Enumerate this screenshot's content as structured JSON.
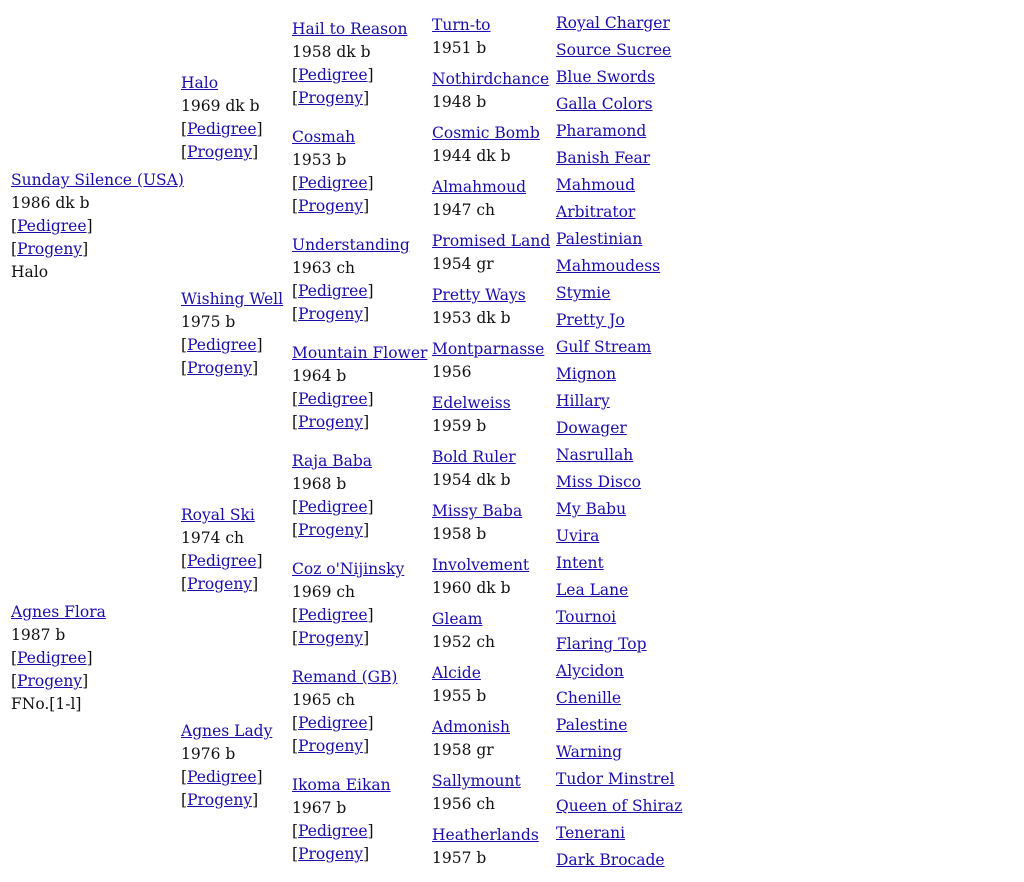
{
  "link_open": "[",
  "link_close": "]",
  "pedigree_label": "Pedigree",
  "progeny_label": "Progeny",
  "sire": {
    "name": "Sunday Silence (USA) ",
    "info": "1986 dk b",
    "note": "Halo"
  },
  "dam": {
    "name": "Agnes Flora ",
    "info": "1987 b",
    "note": "FNo.[1-l]"
  },
  "gen2": [
    {
      "name": "Halo ",
      "info": "1969 dk b"
    },
    {
      "name": "Wishing Well ",
      "info": "1975 b"
    },
    {
      "name": "Royal Ski ",
      "info": "1974 ch"
    },
    {
      "name": "Agnes Lady ",
      "info": "1976 b"
    }
  ],
  "gen3": [
    {
      "name": "Hail to Reason ",
      "info": "1958 dk b"
    },
    {
      "name": "Cosmah",
      "info": "1953 b"
    },
    {
      "name": "Understanding ",
      "info": "1963 ch"
    },
    {
      "name": "Mountain Flower ",
      "info": "1964 b"
    },
    {
      "name": "Raja Baba ",
      "info": "1968 b"
    },
    {
      "name": "Coz o'Nijinsky ",
      "info": "1969 ch"
    },
    {
      "name": "Remand (GB) ",
      "info": "1965 ch"
    },
    {
      "name": "Ikoma Eikan ",
      "info": "1967 b"
    }
  ],
  "gen4": [
    {
      "name": "Turn-to",
      "info": "1951 b"
    },
    {
      "name": "Nothirdchance",
      "info": "1948 b"
    },
    {
      "name": "Cosmic Bomb",
      "info": "1944 dk b"
    },
    {
      "name": "Almahmoud",
      "info": "1947 ch"
    },
    {
      "name": "Promised Land",
      "info": "1954 gr"
    },
    {
      "name": "Pretty Ways",
      "info": "1953 dk b"
    },
    {
      "name": "Montparnasse",
      "info": "1956"
    },
    {
      "name": "Edelweiss",
      "info": "1959 b"
    },
    {
      "name": "Bold Ruler",
      "info": "1954 dk b"
    },
    {
      "name": "Missy Baba",
      "info": "1958 b"
    },
    {
      "name": "Involvement",
      "info": "1960 dk b"
    },
    {
      "name": "Gleam",
      "info": "1952 ch"
    },
    {
      "name": "Alcide",
      "info": "1955 b"
    },
    {
      "name": "Admonish",
      "info": "1958 gr"
    },
    {
      "name": "Sallymount",
      "info": "1956 ch"
    },
    {
      "name": "Heatherlands",
      "info": "1957 b"
    }
  ],
  "gen5": [
    "Royal Charger",
    "Source Sucree",
    "Blue Swords",
    "Galla Colors",
    "Pharamond",
    "Banish Fear",
    "Mahmoud",
    "Arbitrator",
    "Palestinian",
    "Mahmoudess",
    "Stymie",
    "Pretty Jo",
    "Gulf Stream",
    "Mignon",
    "Hillary",
    "Dowager",
    "Nasrullah",
    "Miss Disco",
    "My Babu",
    "Uvira",
    "Intent",
    "Lea Lane",
    "Tournoi",
    "Flaring Top",
    "Alycidon",
    "Chenille",
    "Palestine",
    "Warning",
    "Tudor Minstrel",
    "Queen of Shiraz",
    "Tenerani",
    "Dark Brocade"
  ]
}
